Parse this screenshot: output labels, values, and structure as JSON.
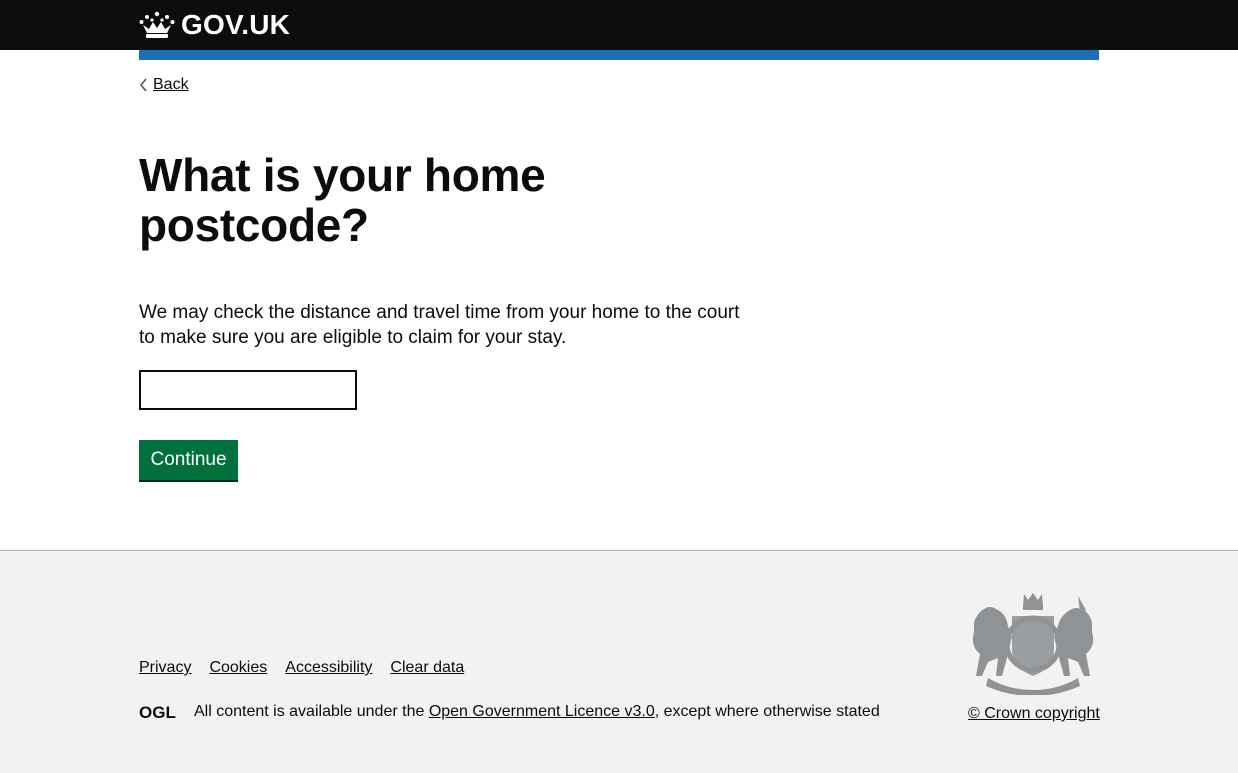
{
  "header": {
    "logo_text": "GOV.UK"
  },
  "nav": {
    "back_label": "Back"
  },
  "main": {
    "heading": "What is your home postcode?",
    "hint": "We may check the distance and travel time from your home to the court to make sure you are eligible to claim for your stay.",
    "postcode_value": "",
    "continue_label": "Continue"
  },
  "footer": {
    "links": [
      "Privacy",
      "Cookies",
      "Accessibility",
      "Clear data"
    ],
    "licence_prefix": "All content is available under the ",
    "licence_link": "Open Government Licence v3.0",
    "licence_suffix": ", except where otherwise stated",
    "ogl_logo": "OGL",
    "copyright": "© Crown copyright"
  },
  "colors": {
    "header_bg": "#0b0c0c",
    "brand_blue": "#1d70b8",
    "button_green": "#00703c",
    "footer_bg": "#f3f2f1"
  },
  "icons": [
    "crown-icon",
    "chevron-left-icon",
    "ogl-logo-icon",
    "royal-coat-of-arms-icon"
  ]
}
